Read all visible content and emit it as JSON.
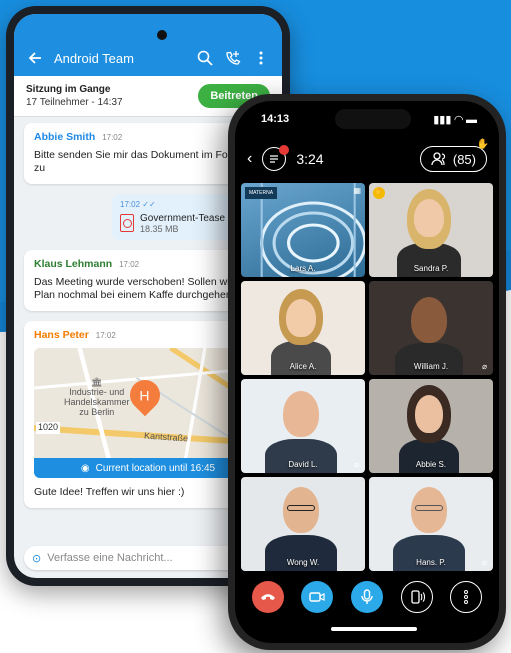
{
  "android": {
    "header": {
      "title": "Android Team"
    },
    "meeting": {
      "title": "Sitzung im Gange",
      "participants": "17 Teilnehmer",
      "separator": "-",
      "time": "14:37",
      "join_label": "Beitreten"
    },
    "messages": [
      {
        "name": "Abbie Smith",
        "time": "17:02",
        "text": "Bitte senden Sie mir das Dokument im Format zu",
        "color": "#1e88e5"
      },
      {
        "name": "Klaus Lehmann",
        "time": "17:02",
        "text": "Das Meeting wurde verschoben! Sollen wir den Plan nochmal bei einem Kaffe durchgehen?",
        "color": "#2e7d32"
      },
      {
        "name": "Hans Peter",
        "time": "17:02",
        "text": "Gute Idee! Treffen wir uns hier :)",
        "color": "#f57c00"
      }
    ],
    "file": {
      "time": "17:02",
      "name": "Government-Tease",
      "size": "18.35 MB"
    },
    "map": {
      "place": "Industrie- und Handelskammer zu Berlin",
      "place_line1": "Industrie- und",
      "place_line2": "Handelskammer",
      "place_line3": "zu Berlin",
      "street": "Kantstraße",
      "number": "1020",
      "road": "L 1",
      "marker": "H",
      "location_label": "Current location until 16:45"
    },
    "input": {
      "placeholder": "Verfasse eine Nachricht..."
    }
  },
  "iphone": {
    "status": {
      "time": "14:13"
    },
    "call": {
      "duration": "3:24",
      "participant_count": "(85)"
    },
    "tiles": [
      {
        "name": "Lars A.",
        "badge": "MATERNA"
      },
      {
        "name": "Sandra P."
      },
      {
        "name": "Alice A."
      },
      {
        "name": "William J."
      },
      {
        "name": "David L."
      },
      {
        "name": "Abbie S."
      },
      {
        "name": "Wong W."
      },
      {
        "name": "Hans. P."
      }
    ],
    "controls": [
      "hangup",
      "video",
      "microphone",
      "audio-output",
      "more"
    ]
  },
  "colors": {
    "brand_blue": "#1e8fe0",
    "join_green": "#3cb043",
    "hangup_red": "#e5584a",
    "control_blue": "#2ba9e8"
  }
}
